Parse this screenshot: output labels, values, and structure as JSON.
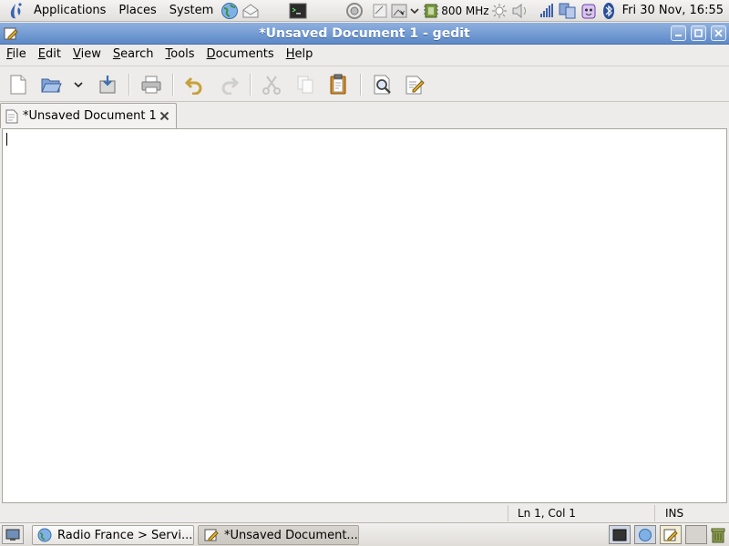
{
  "top_panel": {
    "menus": [
      "Applications",
      "Places",
      "System"
    ],
    "launchers": [
      "gnome-foot-icon",
      "web-browser-icon",
      "mail-icon",
      "terminal-icon"
    ],
    "tray_icons": [
      "network-icon",
      "notes-icon",
      "image-icon",
      "dropdown-arrow-icon",
      "cpu-icon",
      "brightness-icon",
      "volume-icon",
      "signal-icon",
      "network-manager-icon",
      "face-icon",
      "bluetooth-icon"
    ],
    "cpu_freq": "800 MHz",
    "clock": "Fri 30 Nov, 16:55"
  },
  "window": {
    "title": "*Unsaved Document 1 - gedit",
    "controls": [
      "minimize",
      "maximize",
      "close"
    ]
  },
  "menubar": {
    "items": [
      {
        "label": "File",
        "mnemonic": "F",
        "rest": "ile"
      },
      {
        "label": "Edit",
        "mnemonic": "E",
        "rest": "dit"
      },
      {
        "label": "View",
        "mnemonic": "V",
        "rest": "iew"
      },
      {
        "label": "Search",
        "mnemonic": "S",
        "rest": "earch"
      },
      {
        "label": "Tools",
        "mnemonic": "T",
        "rest": "ools"
      },
      {
        "label": "Documents",
        "mnemonic": "D",
        "rest": "ocuments"
      },
      {
        "label": "Help",
        "mnemonic": "H",
        "rest": "elp"
      }
    ]
  },
  "toolbar": {
    "buttons": [
      "new",
      "open",
      "open-recent",
      "save",
      "print",
      "undo",
      "redo",
      "cut",
      "copy",
      "paste",
      "find",
      "replace"
    ]
  },
  "tabs": [
    {
      "label": "*Unsaved Document 1",
      "active": true
    }
  ],
  "editor": {
    "content": ""
  },
  "statusbar": {
    "position": "Ln 1, Col 1",
    "mode": "INS"
  },
  "taskbar": {
    "tasks": [
      {
        "label": "Radio France > Servi...",
        "icon": "web-browser-icon",
        "active": false
      },
      {
        "label": "*Unsaved Document...",
        "icon": "text-editor-icon",
        "active": true
      }
    ]
  },
  "colors": {
    "titlebar": "#6f97cf",
    "undo": "#c7a13a",
    "clipboard": "#d88a1a"
  }
}
